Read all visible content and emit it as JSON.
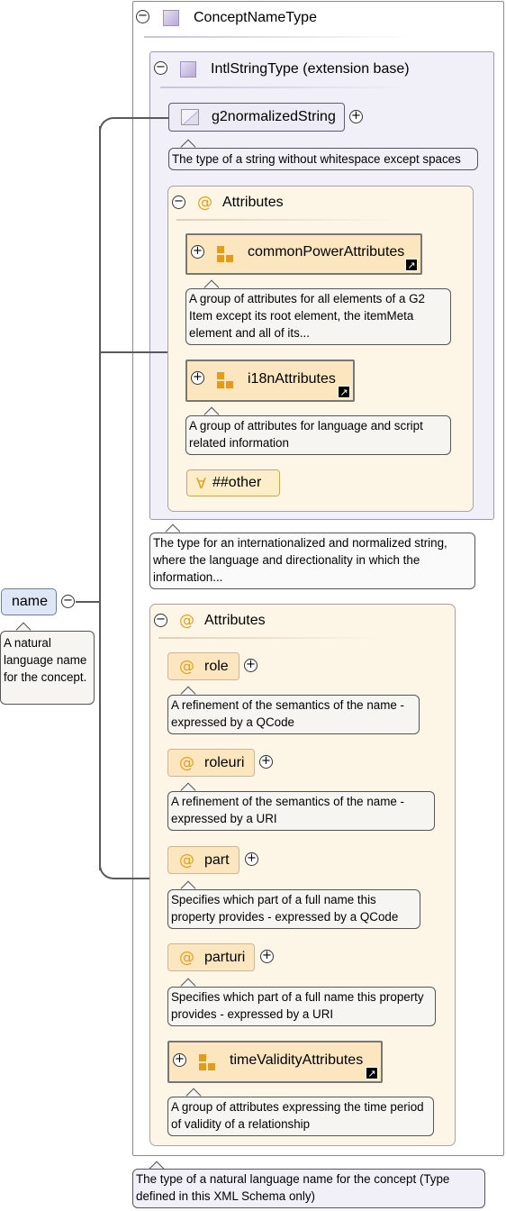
{
  "root_element": {
    "name": "name",
    "documentation": "A natural language name for the concept."
  },
  "complex_type": {
    "title": "ConceptNameType",
    "documentation": "The type of a natural language name for the concept (Type defined in this XML Schema only)"
  },
  "extension_base": {
    "title": "IntlStringType (extension base)",
    "documentation": "The type for an internationalized and normalized string, where the language and directionality in which the information...",
    "simple_type": {
      "name": "g2normalizedString",
      "documentation": "The type of a string without whitespace except spaces"
    },
    "attributes": {
      "title": "Attributes",
      "groups": [
        {
          "name": "commonPowerAttributes",
          "documentation": "A group of attributes for all elements of a G2 Item except its root element, the itemMeta element and all of its..."
        },
        {
          "name": "i18nAttributes",
          "documentation": "A group of attributes for language and script related information"
        }
      ],
      "any_attribute": "##other"
    }
  },
  "own_attributes": {
    "title": "Attributes",
    "items": [
      {
        "name": "role",
        "documentation": "A refinement of the semantics of the name - expressed by a QCode"
      },
      {
        "name": "roleuri",
        "documentation": "A refinement of the semantics of the name - expressed by a URI"
      },
      {
        "name": "part",
        "documentation": "Specifies which part of a full name this property provides - expressed by a QCode"
      },
      {
        "name": "parturi",
        "documentation": "Specifies which part of a full name this property provides - expressed by a URI"
      }
    ],
    "group": {
      "name": "timeValidityAttributes",
      "documentation": "A group of attributes expressing the time period of validity of a relationship"
    }
  },
  "symbols": {
    "collapse": "−",
    "expand": "+",
    "attribute": "@",
    "any": "∀",
    "shortcut": "↗"
  },
  "colors": {
    "type_frame": "#f1f0f8",
    "attribute_frame": "#fdf5e6",
    "attribute_node": "#fbe6c0",
    "attribute_symbol": "#e5a01f",
    "element_node": "#dde7f6"
  }
}
